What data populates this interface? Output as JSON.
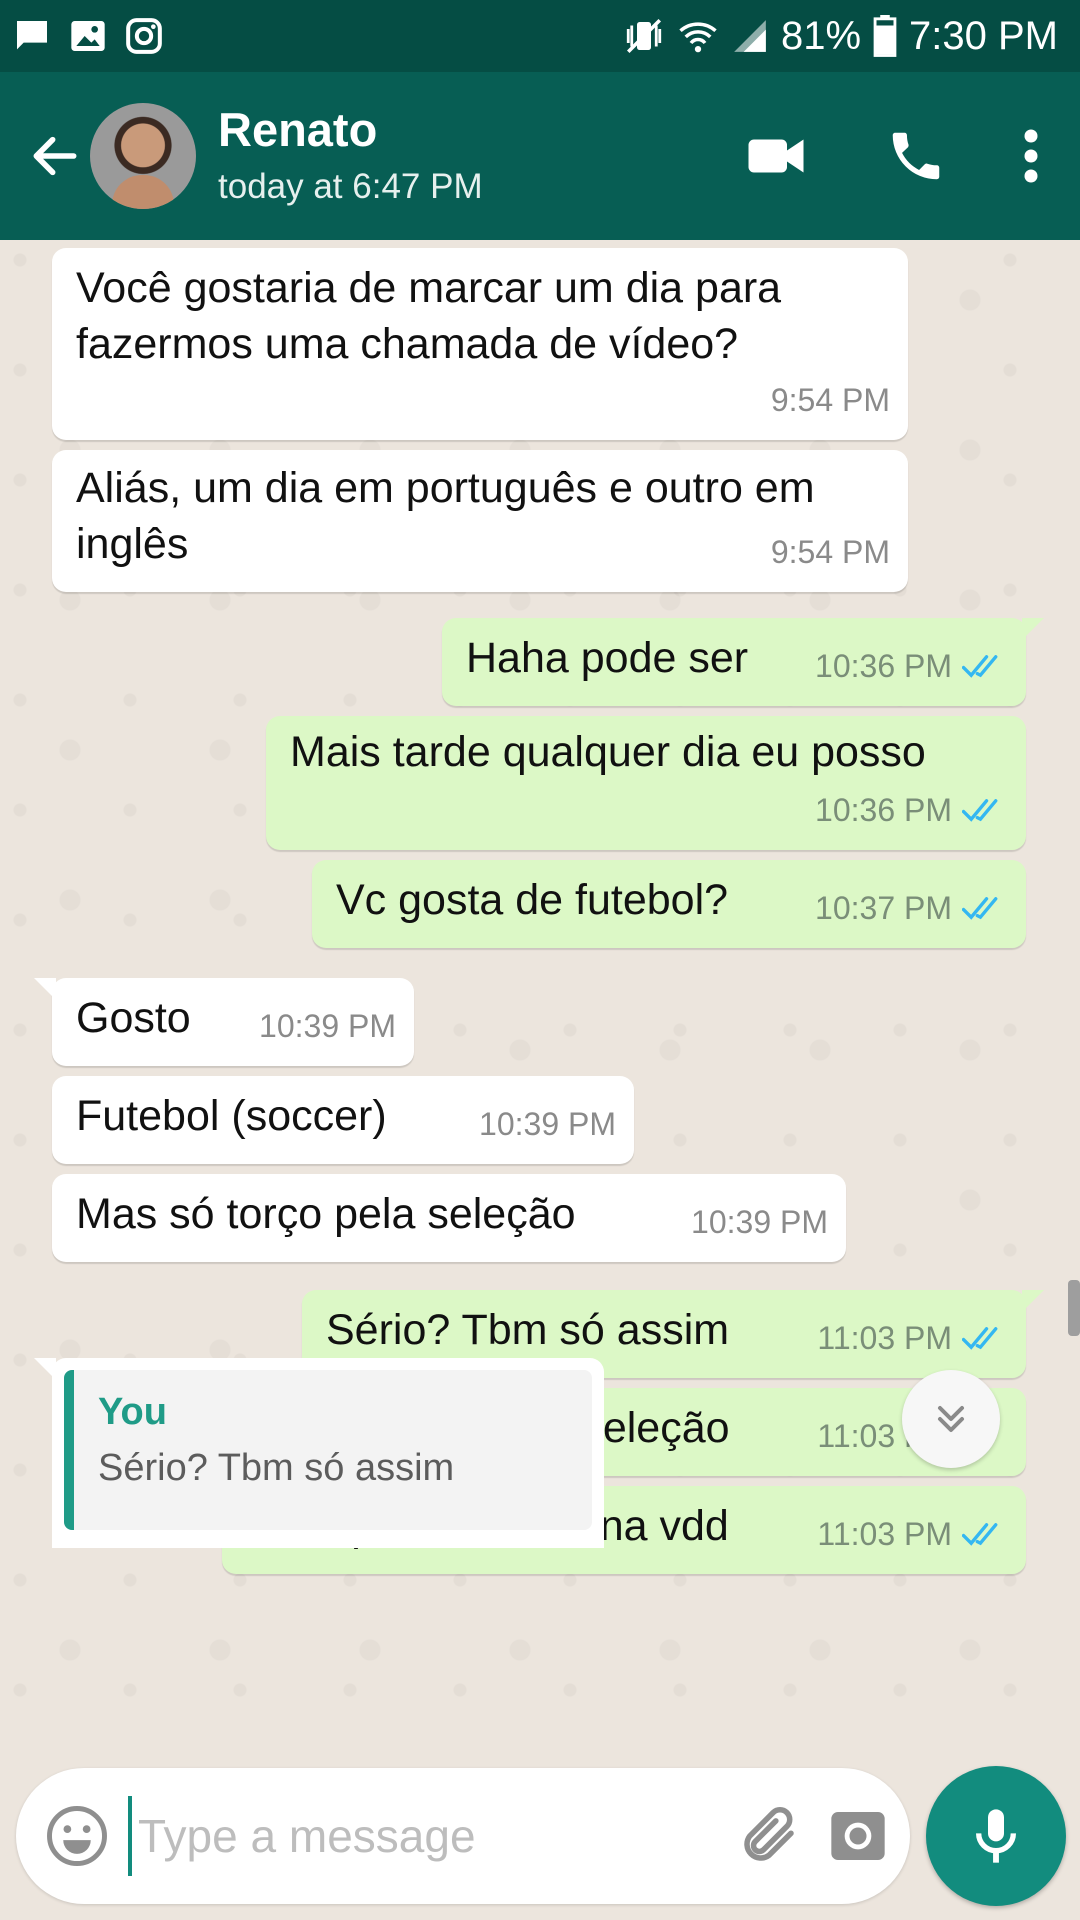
{
  "status_bar": {
    "battery": "81%",
    "time": "7:30 PM",
    "icons_left": [
      "message-icon",
      "image-icon",
      "instagram-icon"
    ],
    "icons_right": [
      "mute-vibrate-icon",
      "wifi-icon",
      "signal-icon",
      "battery-icon"
    ]
  },
  "header": {
    "contact_name": "Renato",
    "last_seen": "today at 6:47 PM",
    "icons": [
      "back-arrow-icon",
      "video-call-icon",
      "phone-icon",
      "more-vert-icon"
    ]
  },
  "messages": [
    {
      "dir": "in",
      "text": "Você gostaria de marcar um dia para fazermos uma chamada de vídeo?",
      "time": "9:54 PM"
    },
    {
      "dir": "in",
      "text": "Aliás, um dia em português e outro em inglês",
      "time": "9:54 PM"
    },
    {
      "dir": "out",
      "text": "Haha pode ser",
      "time": "10:36 PM",
      "read": true
    },
    {
      "dir": "out",
      "text": "Mais tarde qualquer dia eu posso",
      "time": "10:36 PM",
      "read": true
    },
    {
      "dir": "out",
      "text": "Vc gosta de futebol?",
      "time": "10:37 PM",
      "read": true
    },
    {
      "dir": "in",
      "text": "Gosto",
      "time": "10:39 PM"
    },
    {
      "dir": "in",
      "text": "Futebol (soccer)",
      "time": "10:39 PM"
    },
    {
      "dir": "in",
      "text": "Mas só torço pela seleção",
      "time": "10:39 PM"
    },
    {
      "dir": "out",
      "text": "Sério? Tbm só assim",
      "time": "11:03 PM",
      "read": true
    },
    {
      "dir": "out",
      "text": "Só torço pela seleção",
      "time": "11:03 PM",
      "read": true
    },
    {
      "dir": "out",
      "text": "Qualquer time daí na vdd",
      "time": "11:03 PM",
      "read": true
    }
  ],
  "reply_preview": {
    "author": "You",
    "text": "Sério? Tbm só assim"
  },
  "input": {
    "placeholder": "Type a message",
    "value": ""
  },
  "colors": {
    "header": "#075e54",
    "status_bar": "#054d44",
    "outgoing_bubble": "#dcf8c6",
    "incoming_bubble": "#ffffff",
    "accent": "#128c7e",
    "read_ticks": "#34b7f1",
    "chat_background": "#ece5dd"
  }
}
